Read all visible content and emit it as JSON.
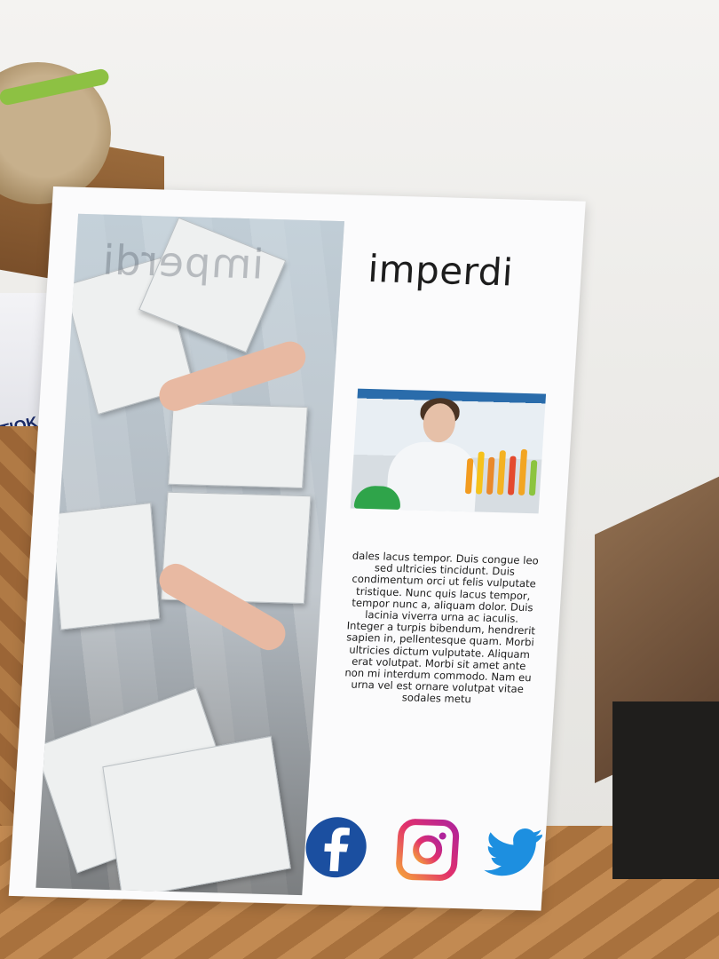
{
  "flyer": {
    "title": "imperdi",
    "watermark": "imperdi",
    "body": "dales lacus tempor. Duis congue leo sed ultricies tincidunt. Duis condimentum orci ut felis vulputate tristique. Nunc quis lacus tempor, tempor nunc a, aliquam dolor. Duis lacinia viverra urna ac iaculis. Integer a turpis bibendum, hendrerit sapien in, pellentesque quam. Morbi ultricies dictum vulputate. Aliquam erat volutpat. Morbi sit amet ante non mi interdum commodo. Nam eu urna vel est ornare volutpat vitae sodales metu",
    "social_icons": [
      "facebook-icon",
      "instagram-icon",
      "twitter-icon"
    ]
  },
  "scene": {
    "bag_text": "TIOK"
  },
  "colors": {
    "facebook": "#1b4fa0",
    "instagram_start": "#f5a33a",
    "instagram_end": "#b0239b",
    "twitter": "#1d8fe0",
    "title": "#1d1d1d"
  }
}
